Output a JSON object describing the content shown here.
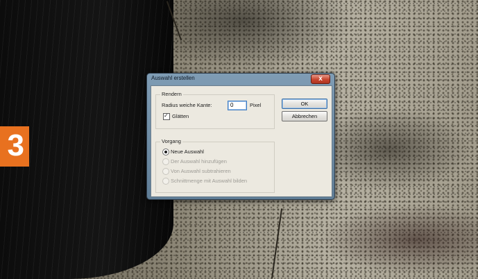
{
  "overlay": {
    "step_number": "3"
  },
  "dialog": {
    "title": "Auswahl erstellen",
    "close_glyph": "x",
    "rendern": {
      "label": "Rendern",
      "radius_label": "Radius weiche Kante:",
      "radius_value": "0",
      "radius_unit": "Pixel",
      "glaetten_label": "Glätten",
      "glaetten_checked": true
    },
    "vorgang": {
      "label": "Vorgang",
      "options": [
        {
          "label": "Neue Auswahl",
          "selected": true,
          "enabled": true
        },
        {
          "label": "Der Auswahl hinzufügen",
          "selected": false,
          "enabled": false
        },
        {
          "label": "Von Auswahl subtrahieren",
          "selected": false,
          "enabled": false
        },
        {
          "label": "Schnittmenge mit Auswahl bilden",
          "selected": false,
          "enabled": false
        }
      ]
    },
    "buttons": {
      "ok": "OK",
      "cancel": "Abbrechen"
    }
  },
  "colors": {
    "badge": "#e8711f",
    "title_bar": "#6f8ca5",
    "close_button": "#c8452e"
  }
}
